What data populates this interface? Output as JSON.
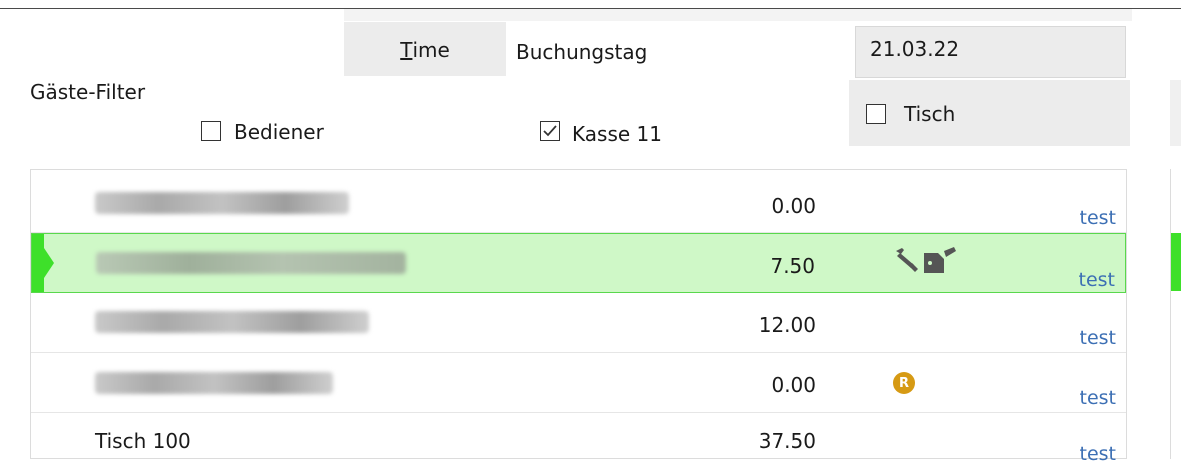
{
  "header": {
    "time_button": {
      "accel": "T",
      "rest": "ime"
    },
    "booking_day_label": "Buchungstag",
    "date_value": "21.03.22"
  },
  "filters": {
    "title": "Gäste-Filter",
    "bediener": {
      "label": "Bediener",
      "checked": false
    },
    "kasse": {
      "label": "Kasse 11",
      "checked": true
    },
    "tisch": {
      "label": "Tisch",
      "checked": false
    }
  },
  "guest_list": {
    "rows": [
      {
        "name": "",
        "name_blurred": true,
        "amount": "0.00",
        "icon": "",
        "tag": "test",
        "selected": false
      },
      {
        "name": "",
        "name_blurred": true,
        "amount": "7.50",
        "icon": "payment-tools-icon",
        "tag": "test",
        "selected": true
      },
      {
        "name": "",
        "name_blurred": true,
        "amount": "12.00",
        "icon": "",
        "tag": "test",
        "selected": false
      },
      {
        "name": "",
        "name_blurred": true,
        "amount": "0.00",
        "icon": "r-badge-icon",
        "badge_letter": "R",
        "tag": "test",
        "selected": false
      },
      {
        "name": "Tisch 100",
        "name_blurred": false,
        "amount": "37.50",
        "icon": "",
        "tag": "test",
        "selected": false
      }
    ]
  },
  "colors": {
    "selection_bg": "#cff8c7",
    "selection_marker": "#3ee02a",
    "tag_text": "#3c6fb4",
    "badge": "#d69a14"
  }
}
